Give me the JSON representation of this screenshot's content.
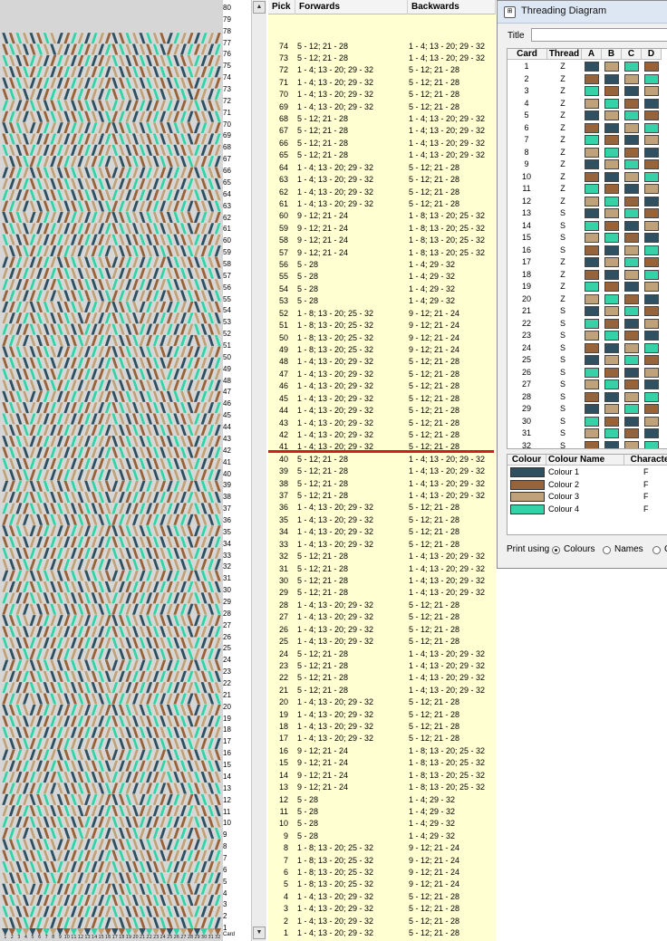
{
  "weave": {
    "colors": {
      "c1": "#2f5061",
      "c2": "#97633a",
      "c3": "#bfa27a",
      "c4": "#36d1a6"
    },
    "bottom_ticks": [
      "1",
      "2",
      "3",
      "4",
      "5",
      "6",
      "7",
      "8",
      "9",
      "10",
      "11",
      "12",
      "13",
      "14",
      "15",
      "16",
      "17",
      "18",
      "19",
      "20",
      "21",
      "22",
      "23",
      "24",
      "25",
      "26",
      "27",
      "28",
      "29",
      "30",
      "31",
      "32"
    ],
    "corner_label": "Card"
  },
  "ruler": {
    "labels": [
      "80",
      "79",
      "78",
      "77",
      "76",
      "75",
      "74",
      "73",
      "72",
      "71",
      "70",
      "69",
      "68",
      "67",
      "66",
      "65",
      "64",
      "63",
      "62",
      "61",
      "60",
      "59",
      "58",
      "57",
      "56",
      "55",
      "54",
      "53",
      "52",
      "51",
      "50",
      "49",
      "48",
      "47",
      "46",
      "45",
      "44",
      "43",
      "42",
      "41",
      "40",
      "39",
      "38",
      "37",
      "36",
      "35",
      "34",
      "33",
      "32",
      "31",
      "30",
      "29",
      "28",
      "27",
      "26",
      "25",
      "24",
      "23",
      "22",
      "21",
      "20",
      "19",
      "18",
      "17",
      "16",
      "15",
      "14",
      "13",
      "12",
      "11",
      "10",
      "9",
      "8",
      "7",
      "6",
      "5",
      "4",
      "3",
      "2",
      "1"
    ]
  },
  "scrollbar": {
    "up": "▲",
    "down": "▼"
  },
  "picks": {
    "headers": {
      "pick": "Pick",
      "forwards": "Forwards",
      "backwards": "Backwards"
    },
    "rows": [
      {
        "n": "74",
        "f": "5 - 12; 21 - 28",
        "b": "1 - 4; 13 - 20; 29 - 32"
      },
      {
        "n": "73",
        "f": "5 - 12; 21 - 28",
        "b": "1 - 4; 13 - 20; 29 - 32"
      },
      {
        "n": "72",
        "f": "1 - 4; 13 - 20; 29 - 32",
        "b": "5 - 12; 21 - 28"
      },
      {
        "n": "71",
        "f": "1 - 4; 13 - 20; 29 - 32",
        "b": "5 - 12; 21 - 28"
      },
      {
        "n": "70",
        "f": "1 - 4; 13 - 20; 29 - 32",
        "b": "5 - 12; 21 - 28"
      },
      {
        "n": "69",
        "f": "1 - 4; 13 - 20; 29 - 32",
        "b": "5 - 12; 21 - 28"
      },
      {
        "n": "68",
        "f": "5 - 12; 21 - 28",
        "b": "1 - 4; 13 - 20; 29 - 32"
      },
      {
        "n": "67",
        "f": "5 - 12; 21 - 28",
        "b": "1 - 4; 13 - 20; 29 - 32"
      },
      {
        "n": "66",
        "f": "5 - 12; 21 - 28",
        "b": "1 - 4; 13 - 20; 29 - 32"
      },
      {
        "n": "65",
        "f": "5 - 12; 21 - 28",
        "b": "1 - 4; 13 - 20; 29 - 32"
      },
      {
        "n": "64",
        "f": "1 - 4; 13 - 20; 29 - 32",
        "b": "5 - 12; 21 - 28"
      },
      {
        "n": "63",
        "f": "1 - 4; 13 - 20; 29 - 32",
        "b": "5 - 12; 21 - 28"
      },
      {
        "n": "62",
        "f": "1 - 4; 13 - 20; 29 - 32",
        "b": "5 - 12; 21 - 28"
      },
      {
        "n": "61",
        "f": "1 - 4; 13 - 20; 29 - 32",
        "b": "5 - 12; 21 - 28"
      },
      {
        "n": "60",
        "f": "9 - 12; 21 - 24",
        "b": "1 - 8; 13 - 20; 25 - 32"
      },
      {
        "n": "59",
        "f": "9 - 12; 21 - 24",
        "b": "1 - 8; 13 - 20; 25 - 32"
      },
      {
        "n": "58",
        "f": "9 - 12; 21 - 24",
        "b": "1 - 8; 13 - 20; 25 - 32"
      },
      {
        "n": "57",
        "f": "9 - 12; 21 - 24",
        "b": "1 - 8; 13 - 20; 25 - 32"
      },
      {
        "n": "56",
        "f": "5 - 28",
        "b": "1 - 4; 29 - 32"
      },
      {
        "n": "55",
        "f": "5 - 28",
        "b": "1 - 4; 29 - 32"
      },
      {
        "n": "54",
        "f": "5 - 28",
        "b": "1 - 4; 29 - 32"
      },
      {
        "n": "53",
        "f": "5 - 28",
        "b": "1 - 4; 29 - 32"
      },
      {
        "n": "52",
        "f": "1 - 8; 13 - 20; 25 - 32",
        "b": "9 - 12; 21 - 24"
      },
      {
        "n": "51",
        "f": "1 - 8; 13 - 20; 25 - 32",
        "b": "9 - 12; 21 - 24"
      },
      {
        "n": "50",
        "f": "1 - 8; 13 - 20; 25 - 32",
        "b": "9 - 12; 21 - 24"
      },
      {
        "n": "49",
        "f": "1 - 8; 13 - 20; 25 - 32",
        "b": "9 - 12; 21 - 24"
      },
      {
        "n": "48",
        "f": "1 - 4; 13 - 20; 29 - 32",
        "b": "5 - 12; 21 - 28"
      },
      {
        "n": "47",
        "f": "1 - 4; 13 - 20; 29 - 32",
        "b": "5 - 12; 21 - 28"
      },
      {
        "n": "46",
        "f": "1 - 4; 13 - 20; 29 - 32",
        "b": "5 - 12; 21 - 28"
      },
      {
        "n": "45",
        "f": "1 - 4; 13 - 20; 29 - 32",
        "b": "5 - 12; 21 - 28"
      },
      {
        "n": "44",
        "f": "1 - 4; 13 - 20; 29 - 32",
        "b": "5 - 12; 21 - 28"
      },
      {
        "n": "43",
        "f": "1 - 4; 13 - 20; 29 - 32",
        "b": "5 - 12; 21 - 28"
      },
      {
        "n": "42",
        "f": "1 - 4; 13 - 20; 29 - 32",
        "b": "5 - 12; 21 - 28"
      },
      {
        "n": "41",
        "f": "1 - 4; 13 - 20; 29 - 32",
        "b": "5 - 12; 21 - 28"
      },
      {
        "n": "40",
        "f": "5 - 12; 21 - 28",
        "b": "1 - 4; 13 - 20; 29 - 32"
      },
      {
        "n": "39",
        "f": "5 - 12; 21 - 28",
        "b": "1 - 4; 13 - 20; 29 - 32"
      },
      {
        "n": "38",
        "f": "5 - 12; 21 - 28",
        "b": "1 - 4; 13 - 20; 29 - 32"
      },
      {
        "n": "37",
        "f": "5 - 12; 21 - 28",
        "b": "1 - 4; 13 - 20; 29 - 32"
      },
      {
        "n": "36",
        "f": "1 - 4; 13 - 20; 29 - 32",
        "b": "5 - 12; 21 - 28"
      },
      {
        "n": "35",
        "f": "1 - 4; 13 - 20; 29 - 32",
        "b": "5 - 12; 21 - 28"
      },
      {
        "n": "34",
        "f": "1 - 4; 13 - 20; 29 - 32",
        "b": "5 - 12; 21 - 28"
      },
      {
        "n": "33",
        "f": "1 - 4; 13 - 20; 29 - 32",
        "b": "5 - 12; 21 - 28"
      },
      {
        "n": "32",
        "f": "5 - 12; 21 - 28",
        "b": "1 - 4; 13 - 20; 29 - 32"
      },
      {
        "n": "31",
        "f": "5 - 12; 21 - 28",
        "b": "1 - 4; 13 - 20; 29 - 32"
      },
      {
        "n": "30",
        "f": "5 - 12; 21 - 28",
        "b": "1 - 4; 13 - 20; 29 - 32"
      },
      {
        "n": "29",
        "f": "5 - 12; 21 - 28",
        "b": "1 - 4; 13 - 20; 29 - 32"
      },
      {
        "n": "28",
        "f": "1 - 4; 13 - 20; 29 - 32",
        "b": "5 - 12; 21 - 28"
      },
      {
        "n": "27",
        "f": "1 - 4; 13 - 20; 29 - 32",
        "b": "5 - 12; 21 - 28"
      },
      {
        "n": "26",
        "f": "1 - 4; 13 - 20; 29 - 32",
        "b": "5 - 12; 21 - 28"
      },
      {
        "n": "25",
        "f": "1 - 4; 13 - 20; 29 - 32",
        "b": "5 - 12; 21 - 28"
      },
      {
        "n": "24",
        "f": "5 - 12; 21 - 28",
        "b": "1 - 4; 13 - 20; 29 - 32"
      },
      {
        "n": "23",
        "f": "5 - 12; 21 - 28",
        "b": "1 - 4; 13 - 20; 29 - 32"
      },
      {
        "n": "22",
        "f": "5 - 12; 21 - 28",
        "b": "1 - 4; 13 - 20; 29 - 32"
      },
      {
        "n": "21",
        "f": "5 - 12; 21 - 28",
        "b": "1 - 4; 13 - 20; 29 - 32"
      },
      {
        "n": "20",
        "f": "1 - 4; 13 - 20; 29 - 32",
        "b": "5 - 12; 21 - 28"
      },
      {
        "n": "19",
        "f": "1 - 4; 13 - 20; 29 - 32",
        "b": "5 - 12; 21 - 28"
      },
      {
        "n": "18",
        "f": "1 - 4; 13 - 20; 29 - 32",
        "b": "5 - 12; 21 - 28"
      },
      {
        "n": "17",
        "f": "1 - 4; 13 - 20; 29 - 32",
        "b": "5 - 12; 21 - 28"
      },
      {
        "n": "16",
        "f": "9 - 12; 21 - 24",
        "b": "1 - 8; 13 - 20; 25 - 32"
      },
      {
        "n": "15",
        "f": "9 - 12; 21 - 24",
        "b": "1 - 8; 13 - 20; 25 - 32"
      },
      {
        "n": "14",
        "f": "9 - 12; 21 - 24",
        "b": "1 - 8; 13 - 20; 25 - 32"
      },
      {
        "n": "13",
        "f": "9 - 12; 21 - 24",
        "b": "1 - 8; 13 - 20; 25 - 32"
      },
      {
        "n": "12",
        "f": "5 - 28",
        "b": "1 - 4; 29 - 32"
      },
      {
        "n": "11",
        "f": "5 - 28",
        "b": "1 - 4; 29 - 32"
      },
      {
        "n": "10",
        "f": "5 - 28",
        "b": "1 - 4; 29 - 32"
      },
      {
        "n": "9",
        "f": "5 - 28",
        "b": "1 - 4; 29 - 32"
      },
      {
        "n": "8",
        "f": "1 - 8; 13 - 20; 25 - 32",
        "b": "9 - 12; 21 - 24"
      },
      {
        "n": "7",
        "f": "1 - 8; 13 - 20; 25 - 32",
        "b": "9 - 12; 21 - 24"
      },
      {
        "n": "6",
        "f": "1 - 8; 13 - 20; 25 - 32",
        "b": "9 - 12; 21 - 24"
      },
      {
        "n": "5",
        "f": "1 - 8; 13 - 20; 25 - 32",
        "b": "9 - 12; 21 - 24"
      },
      {
        "n": "4",
        "f": "1 - 4; 13 - 20; 29 - 32",
        "b": "5 - 12; 21 - 28"
      },
      {
        "n": "3",
        "f": "1 - 4; 13 - 20; 29 - 32",
        "b": "5 - 12; 21 - 28"
      },
      {
        "n": "2",
        "f": "1 - 4; 13 - 20; 29 - 32",
        "b": "5 - 12; 21 - 28"
      },
      {
        "n": "1",
        "f": "1 - 4; 13 - 20; 29 - 32",
        "b": "5 - 12; 21 - 28"
      }
    ]
  },
  "threading": {
    "window_title": "Threading Diagram",
    "title_label": "Title",
    "title_value": "",
    "headers": {
      "card": "Card",
      "thread": "Thread",
      "a": "A",
      "b": "B",
      "c": "C",
      "d": "D"
    },
    "cards": [
      {
        "card": "1",
        "thread": "Z",
        "holes": [
          1,
          3,
          4,
          2
        ]
      },
      {
        "card": "2",
        "thread": "Z",
        "holes": [
          2,
          1,
          3,
          4
        ]
      },
      {
        "card": "3",
        "thread": "Z",
        "holes": [
          4,
          2,
          1,
          3
        ]
      },
      {
        "card": "4",
        "thread": "Z",
        "holes": [
          3,
          4,
          2,
          1
        ]
      },
      {
        "card": "5",
        "thread": "Z",
        "holes": [
          1,
          3,
          4,
          2
        ]
      },
      {
        "card": "6",
        "thread": "Z",
        "holes": [
          2,
          1,
          3,
          4
        ]
      },
      {
        "card": "7",
        "thread": "Z",
        "holes": [
          4,
          2,
          1,
          3
        ]
      },
      {
        "card": "8",
        "thread": "Z",
        "holes": [
          3,
          4,
          2,
          1
        ]
      },
      {
        "card": "9",
        "thread": "Z",
        "holes": [
          1,
          3,
          4,
          2
        ]
      },
      {
        "card": "10",
        "thread": "Z",
        "holes": [
          2,
          1,
          3,
          4
        ]
      },
      {
        "card": "11",
        "thread": "Z",
        "holes": [
          4,
          2,
          1,
          3
        ]
      },
      {
        "card": "12",
        "thread": "Z",
        "holes": [
          3,
          4,
          2,
          1
        ]
      },
      {
        "card": "13",
        "thread": "S",
        "holes": [
          1,
          3,
          4,
          2
        ]
      },
      {
        "card": "14",
        "thread": "S",
        "holes": [
          4,
          2,
          1,
          3
        ]
      },
      {
        "card": "15",
        "thread": "S",
        "holes": [
          3,
          4,
          2,
          1
        ]
      },
      {
        "card": "16",
        "thread": "S",
        "holes": [
          2,
          1,
          3,
          4
        ]
      },
      {
        "card": "17",
        "thread": "Z",
        "holes": [
          1,
          3,
          4,
          2
        ]
      },
      {
        "card": "18",
        "thread": "Z",
        "holes": [
          2,
          1,
          3,
          4
        ]
      },
      {
        "card": "19",
        "thread": "Z",
        "holes": [
          4,
          2,
          1,
          3
        ]
      },
      {
        "card": "20",
        "thread": "Z",
        "holes": [
          3,
          4,
          2,
          1
        ]
      },
      {
        "card": "21",
        "thread": "S",
        "holes": [
          1,
          3,
          4,
          2
        ]
      },
      {
        "card": "22",
        "thread": "S",
        "holes": [
          4,
          2,
          1,
          3
        ]
      },
      {
        "card": "23",
        "thread": "S",
        "holes": [
          3,
          4,
          2,
          1
        ]
      },
      {
        "card": "24",
        "thread": "S",
        "holes": [
          2,
          1,
          3,
          4
        ]
      },
      {
        "card": "25",
        "thread": "S",
        "holes": [
          1,
          3,
          4,
          2
        ]
      },
      {
        "card": "26",
        "thread": "S",
        "holes": [
          4,
          2,
          1,
          3
        ]
      },
      {
        "card": "27",
        "thread": "S",
        "holes": [
          3,
          4,
          2,
          1
        ]
      },
      {
        "card": "28",
        "thread": "S",
        "holes": [
          2,
          1,
          3,
          4
        ]
      },
      {
        "card": "29",
        "thread": "S",
        "holes": [
          1,
          3,
          4,
          2
        ]
      },
      {
        "card": "30",
        "thread": "S",
        "holes": [
          4,
          2,
          1,
          3
        ]
      },
      {
        "card": "31",
        "thread": "S",
        "holes": [
          3,
          4,
          2,
          1
        ]
      },
      {
        "card": "32",
        "thread": "S",
        "holes": [
          2,
          1,
          3,
          4
        ]
      }
    ]
  },
  "palette": {
    "headers": {
      "colour": "Colour",
      "name": "Colour Name",
      "character": "Character"
    },
    "items": [
      {
        "name": "Colour 1",
        "char": "F",
        "hex": "#2f5061"
      },
      {
        "name": "Colour 2",
        "char": "F",
        "hex": "#97633a"
      },
      {
        "name": "Colour 3",
        "char": "F",
        "hex": "#bfa27a"
      },
      {
        "name": "Colour 4",
        "char": "F",
        "hex": "#36d1a6"
      }
    ]
  },
  "print_options": {
    "label": "Print using",
    "options": [
      "Colours",
      "Names",
      "C"
    ],
    "selected": 0
  }
}
